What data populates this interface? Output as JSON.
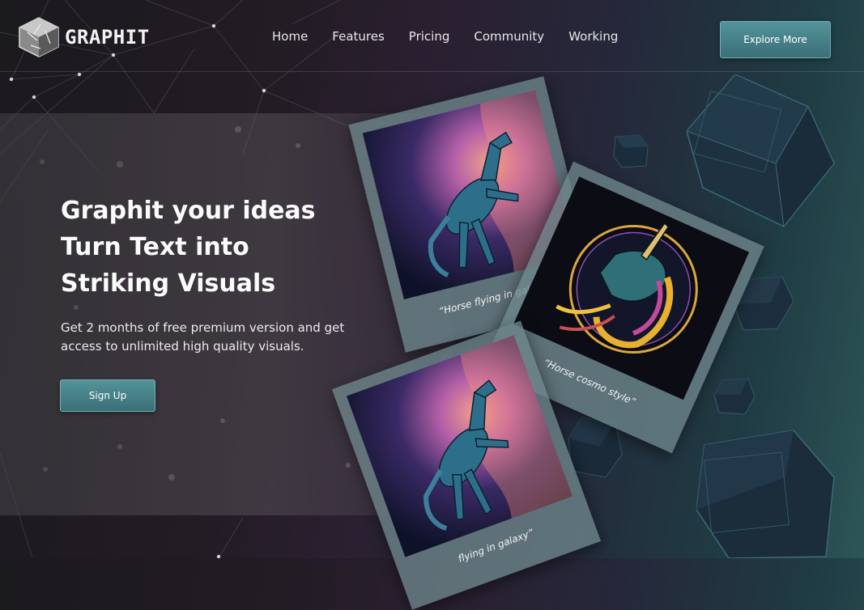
{
  "brand": {
    "name": "GRAPHIT",
    "logo_icon": "hexagon-crystal-logo"
  },
  "nav": {
    "items": [
      "Home",
      "Features",
      "Pricing",
      "Community",
      "Working"
    ]
  },
  "header": {
    "cta_label": "Explore More"
  },
  "hero": {
    "headline_lines": [
      "Graphit your ideas",
      "Turn Text into",
      "Striking Visuals"
    ],
    "subtext_lines": [
      "Get 2 months of free premium version and get",
      "access to unlimited high quality visuals."
    ],
    "signup_label": "Sign Up"
  },
  "cards": [
    {
      "caption": "“Horse flying in galaxy”",
      "image": "rearing-horse-galaxy"
    },
    {
      "caption": "“Horse cosmo style”",
      "image": "unicorn-cosmo"
    },
    {
      "caption": "flying in galaxy”",
      "image": "rearing-horse-galaxy"
    }
  ],
  "colors": {
    "accent": "#4a858c",
    "accent_border": "#6fb2b7",
    "bg_dark": "#1b1a1d",
    "bg_teal": "#2d5557"
  }
}
